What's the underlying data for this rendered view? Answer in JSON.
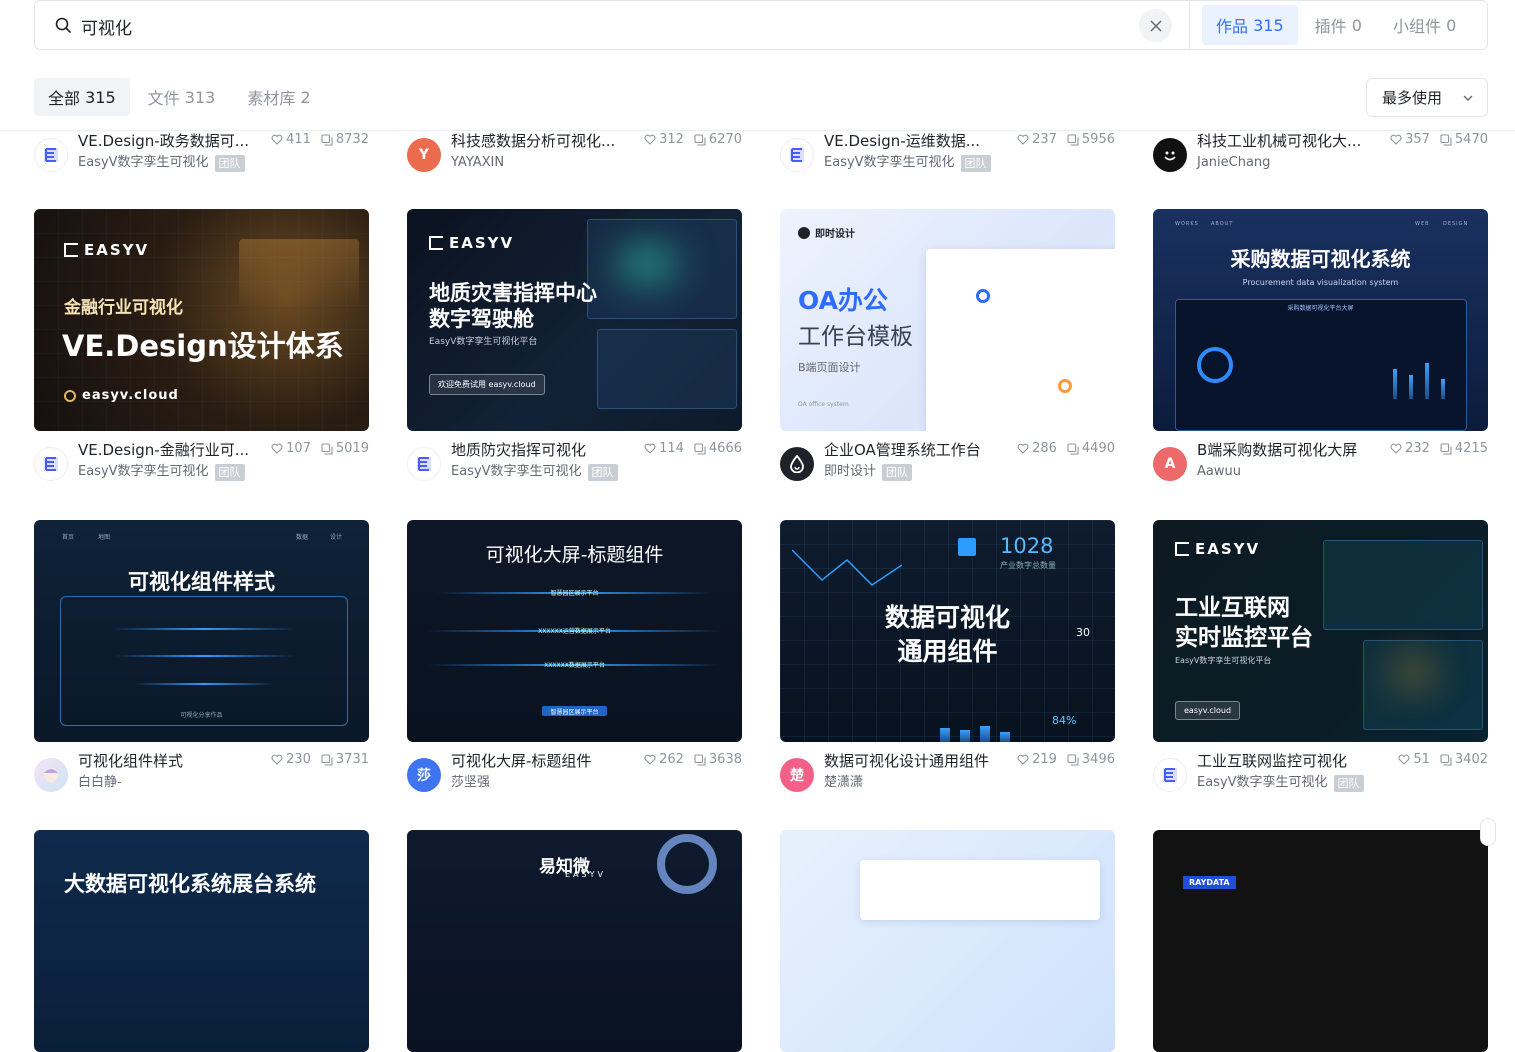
{
  "search": {
    "value": "可视化"
  },
  "type_tabs": [
    {
      "label": "作品",
      "count": "315",
      "active": true
    },
    {
      "label": "插件",
      "count": "0",
      "active": false
    },
    {
      "label": "小组件",
      "count": "0",
      "active": false
    }
  ],
  "filter_tabs": [
    {
      "label": "全部",
      "count": "315",
      "active": true
    },
    {
      "label": "文件",
      "count": "313",
      "active": false
    },
    {
      "label": "素材库",
      "count": "2",
      "active": false
    }
  ],
  "sort": {
    "value": "最多使用"
  },
  "team_badge": "团队",
  "rows": [
    [
      {
        "title": "VE.Design-政务数据可...",
        "author": "EasyV数字孪生可视化",
        "team": true,
        "likes": "411",
        "uses": "8732",
        "avatar": "logo"
      },
      {
        "title": "科技感数据分析可视化...",
        "author": "YAYAXIN",
        "team": false,
        "likes": "312",
        "uses": "6270",
        "avatar": "Y",
        "avatar_color": "#ea6b4e"
      },
      {
        "title": "VE.Design-运维数据...",
        "author": "EasyV数字孪生可视化",
        "team": true,
        "likes": "237",
        "uses": "5956",
        "avatar": "logo"
      },
      {
        "title": "科技工业机械可视化大...",
        "author": "JanieChang",
        "team": false,
        "likes": "357",
        "uses": "5470",
        "avatar": "smile",
        "avatar_color": "#111111"
      }
    ],
    [
      {
        "title": "VE.Design-金融行业可...",
        "author": "EasyV数字孪生可视化",
        "team": true,
        "likes": "107",
        "uses": "5019",
        "avatar": "logo"
      },
      {
        "title": "地质防灾指挥可视化",
        "author": "EasyV数字孪生可视化",
        "team": true,
        "likes": "114",
        "uses": "4666",
        "avatar": "logo"
      },
      {
        "title": "企业OA管理系统工作台",
        "author": "即时设计",
        "team": true,
        "likes": "286",
        "uses": "4490",
        "avatar": "drop",
        "avatar_color": "#1f2329"
      },
      {
        "title": "B端采购数据可视化大屏",
        "author": "Aawuu",
        "team": false,
        "likes": "232",
        "uses": "4215",
        "avatar": "A",
        "avatar_color": "#ee6a6a"
      }
    ],
    [
      {
        "title": "可视化组件样式",
        "author": "白白静-",
        "team": false,
        "likes": "230",
        "uses": "3731",
        "avatar": "anime",
        "avatar_color": "#e8d6f0"
      },
      {
        "title": "可视化大屏-标题组件",
        "author": "莎坚强",
        "team": false,
        "likes": "262",
        "uses": "3638",
        "avatar": "莎",
        "avatar_color": "#3f74f0"
      },
      {
        "title": "数据可视化设计通用组件",
        "author": "楚潇潇",
        "team": false,
        "likes": "219",
        "uses": "3496",
        "avatar": "楚",
        "avatar_color": "#f25f87"
      },
      {
        "title": "工业互联网监控可视化",
        "author": "EasyV数字孪生可视化",
        "team": true,
        "likes": "51",
        "uses": "3402",
        "avatar": "logo"
      }
    ]
  ],
  "thumbs": {
    "t1": {
      "brand": "EASYV",
      "line1": "金融行业可视化",
      "line2": "VE.Design设计体系",
      "url": "easyv.cloud"
    },
    "t2": {
      "brand": "EASYV",
      "line1": "地质灾害指挥中心",
      "line2": "数字驾驶舱",
      "sub": "EasyV数字孪生可视化平台",
      "btn": "欢迎免费试用 easyv.cloud"
    },
    "t3": {
      "brand": "即时设计",
      "line1": "OA办公",
      "line2": "工作台模板",
      "sub": "B端页面设计",
      "foot": "OA office system"
    },
    "t4": {
      "nav": [
        "WORKS",
        "ABOUT",
        "WEB",
        "DESIGN"
      ],
      "line1": "采购数据可视化系统",
      "sub": "Procurement data visualization system",
      "bar": "采购数据可视化平台大屏"
    },
    "t5": {
      "line1": "可视化组件样式",
      "nav": [
        "首页",
        "地图",
        "数据",
        "设计"
      ],
      "foot": "可视化分享作品"
    },
    "t6": {
      "line1": "可视化大屏-标题组件",
      "labels": [
        "智慧园区展示平台",
        "XXXXXX运营数据展示平台",
        "XXXXXX数据展示平台",
        "智慧园区展示平台"
      ]
    },
    "t7": {
      "num": "1028",
      "numlabel": "产业数字总数量",
      "line1": "数据可视化",
      "line2": "通用组件",
      "pct": "84%",
      "val": "30"
    },
    "t8": {
      "brand": "EASYV",
      "line1": "工业互联网",
      "line2": "实时监控平台",
      "sub": "EasyV数字孪生可视化平台",
      "btn": "easyv.cloud"
    },
    "t9": {
      "line1": "大数据可视化系统展台系统"
    },
    "t10": {
      "brand": "易知微",
      "brand2": "EASYV"
    },
    "t12": {
      "brand": "RAYDATA"
    }
  }
}
